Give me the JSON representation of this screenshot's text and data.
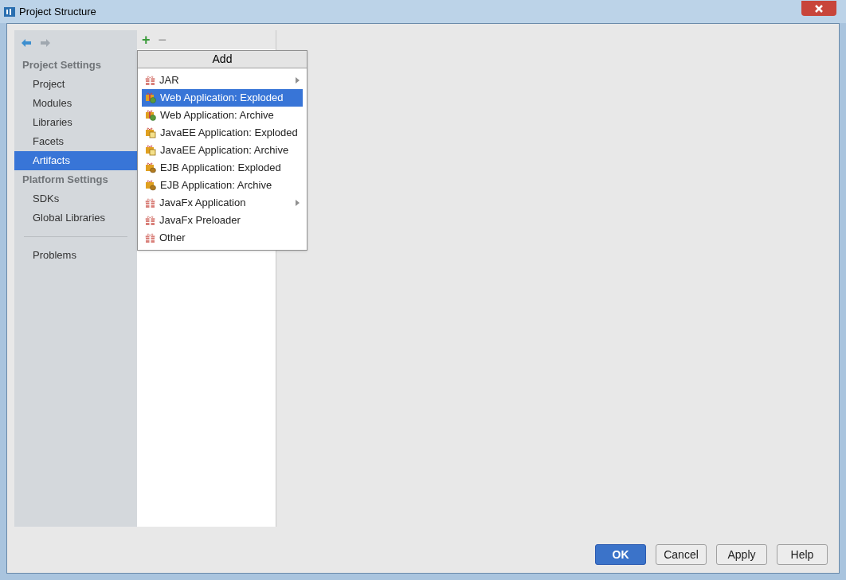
{
  "window": {
    "title": "Project Structure"
  },
  "sidebar": {
    "items": [
      {
        "kind": "header",
        "label": "Project Settings"
      },
      {
        "kind": "item",
        "label": "Project",
        "selected": false
      },
      {
        "kind": "item",
        "label": "Modules",
        "selected": false
      },
      {
        "kind": "item",
        "label": "Libraries",
        "selected": false
      },
      {
        "kind": "item",
        "label": "Facets",
        "selected": false
      },
      {
        "kind": "item",
        "label": "Artifacts",
        "selected": true
      },
      {
        "kind": "header",
        "label": "Platform Settings"
      },
      {
        "kind": "item",
        "label": "SDKs",
        "selected": false
      },
      {
        "kind": "item",
        "label": "Global Libraries",
        "selected": false
      },
      {
        "kind": "separator"
      },
      {
        "kind": "item",
        "label": "Problems",
        "selected": false
      }
    ]
  },
  "toolbar": {
    "add": "+",
    "remove": "−"
  },
  "popup": {
    "title": "Add",
    "items": [
      {
        "kind": "gift",
        "label": "JAR",
        "submenu": true,
        "selected": false
      },
      {
        "kind": "web",
        "label": "Web Application: Exploded",
        "submenu": false,
        "selected": true
      },
      {
        "kind": "web",
        "label": "Web Application: Archive",
        "submenu": false,
        "selected": false
      },
      {
        "kind": "javaee",
        "label": "JavaEE Application: Exploded",
        "submenu": false,
        "selected": false
      },
      {
        "kind": "javaee",
        "label": "JavaEE Application: Archive",
        "submenu": false,
        "selected": false
      },
      {
        "kind": "ejb",
        "label": "EJB Application: Exploded",
        "submenu": false,
        "selected": false
      },
      {
        "kind": "ejb",
        "label": "EJB Application: Archive",
        "submenu": false,
        "selected": false
      },
      {
        "kind": "gift",
        "label": "JavaFx Application",
        "submenu": true,
        "selected": false
      },
      {
        "kind": "gift",
        "label": "JavaFx Preloader",
        "submenu": false,
        "selected": false
      },
      {
        "kind": "gift",
        "label": "Other",
        "submenu": false,
        "selected": false
      }
    ]
  },
  "buttons": [
    {
      "label": "OK",
      "primary": true
    },
    {
      "label": "Cancel",
      "primary": false
    },
    {
      "label": "Apply",
      "primary": false
    },
    {
      "label": "Help",
      "primary": false
    }
  ]
}
